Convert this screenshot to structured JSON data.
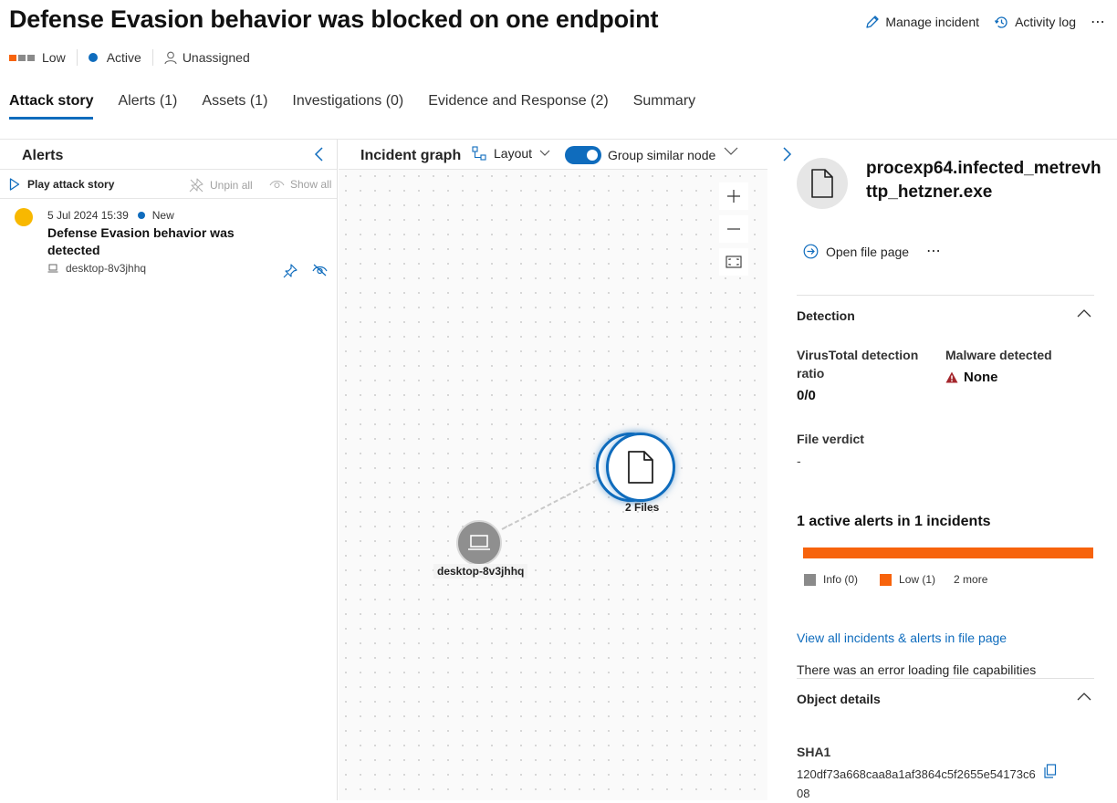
{
  "header": {
    "title": "Defense Evasion behavior was blocked on one endpoint",
    "manage_incident": "Manage incident",
    "activity_log": "Activity log",
    "more": "⋯",
    "severity": "Low",
    "status": "Active",
    "assignee": "Unassigned"
  },
  "colors": {
    "accent": "#0f6cbd",
    "severity_low": "#f7630c",
    "alert_dot": "#f8b800",
    "neutral": "#8a8a8a"
  },
  "tabs": [
    "Attack story",
    "Alerts (1)",
    "Assets (1)",
    "Investigations (0)",
    "Evidence and Response (2)",
    "Summary"
  ],
  "alerts_panel": {
    "title": "Alerts",
    "play": "Play attack story",
    "unpin_all": "Unpin all",
    "show_all": "Show all",
    "item": {
      "date": "5 Jul 2024 15:39",
      "status": "New",
      "name": "Defense Evasion behavior was detected",
      "device": "desktop-8v3jhhq"
    }
  },
  "graph": {
    "title": "Incident graph",
    "layout": "Layout",
    "group_similar": "Group similar node",
    "files_node": "2 Files",
    "device_node": "desktop-8v3jhhq"
  },
  "details": {
    "file_name": "procexp64.infected_metrevhttp_hetzner.exe",
    "open_file_page": "Open file page",
    "more": "⋯",
    "detection_title": "Detection",
    "vt_label": "VirusTotal detection ratio",
    "vt_value": "0/0",
    "malware_label": "Malware detected",
    "malware_value": "None",
    "verdict_label": "File verdict",
    "verdict_value": "-",
    "active_alerts": "1 active alerts in 1 incidents",
    "legend_info": "Info (0)",
    "legend_low": "Low (1)",
    "legend_more": "2 more",
    "view_all_link": "View all incidents & alerts in file page",
    "error_text": "There was an error loading file capabilities",
    "object_details_title": "Object details",
    "sha1_label": "SHA1",
    "sha1_value": "120df73a668caa8a1af3864c5f2655e54173c608"
  }
}
